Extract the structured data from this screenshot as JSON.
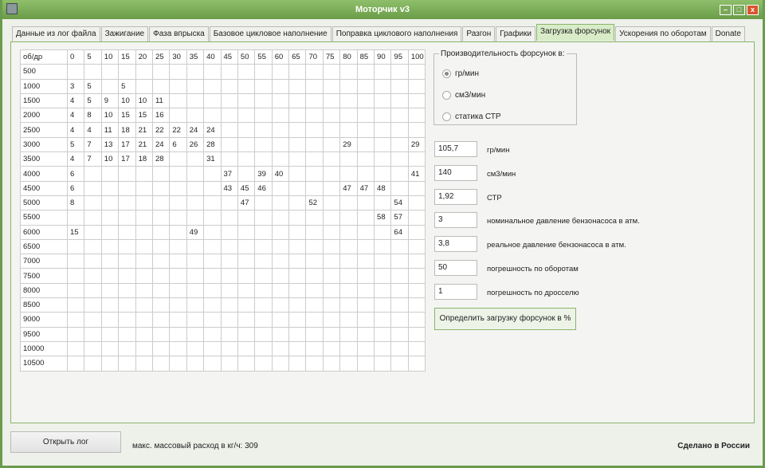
{
  "window": {
    "title": "Моторчик v3"
  },
  "tabs": [
    "Данные из лог файла",
    "Зажигание",
    "Фаза впрыска",
    "Базовое цикловое наполнение",
    "Поправка циклового наполнения",
    "Разгон",
    "Графики",
    "Загрузка форсунок",
    "Ускорения по оборотам",
    "Donate"
  ],
  "active_tab": 7,
  "table": {
    "corner": "об/др",
    "columns": [
      "0",
      "5",
      "10",
      "15",
      "20",
      "25",
      "30",
      "35",
      "40",
      "45",
      "50",
      "55",
      "60",
      "65",
      "70",
      "75",
      "80",
      "85",
      "90",
      "95",
      "100"
    ],
    "rows": [
      {
        "rpm": "500",
        "cells": {}
      },
      {
        "rpm": "1000",
        "cells": {
          "0": "3",
          "5": "5",
          "15": "5"
        }
      },
      {
        "rpm": "1500",
        "cells": {
          "0": "4",
          "5": "5",
          "10": "9",
          "15": "10",
          "20": "10",
          "25": "11"
        }
      },
      {
        "rpm": "2000",
        "cells": {
          "0": "4",
          "5": "8",
          "10": "10",
          "15": "15",
          "20": "15",
          "25": "16"
        }
      },
      {
        "rpm": "2500",
        "cells": {
          "0": "4",
          "5": "4",
          "10": "11",
          "15": "18",
          "20": "21",
          "25": "22",
          "30": "22",
          "35": "24",
          "40": "24"
        }
      },
      {
        "rpm": "3000",
        "cells": {
          "0": "5",
          "5": "7",
          "10": "13",
          "15": "17",
          "20": "21",
          "25": "24",
          "30": "6",
          "35": "26",
          "40": "28",
          "80": "29",
          "100": "29"
        }
      },
      {
        "rpm": "3500",
        "cells": {
          "0": "4",
          "5": "7",
          "10": "10",
          "15": "17",
          "20": "18",
          "25": "28",
          "40": "31"
        }
      },
      {
        "rpm": "4000",
        "cells": {
          "0": "6",
          "45": "37",
          "55": "39",
          "60": "40",
          "100": "41"
        }
      },
      {
        "rpm": "4500",
        "cells": {
          "0": "6",
          "45": "43",
          "50": "45",
          "55": "46",
          "80": "47",
          "85": "47",
          "90": "48"
        }
      },
      {
        "rpm": "5000",
        "cells": {
          "0": "8",
          "50": "47",
          "70": "52",
          "95": "54"
        }
      },
      {
        "rpm": "5500",
        "cells": {
          "90": "58",
          "95": "57"
        }
      },
      {
        "rpm": "6000",
        "cells": {
          "0": "15",
          "35": "49",
          "95": "64"
        }
      },
      {
        "rpm": "6500",
        "cells": {}
      },
      {
        "rpm": "7000",
        "cells": {}
      },
      {
        "rpm": "7500",
        "cells": {}
      },
      {
        "rpm": "8000",
        "cells": {}
      },
      {
        "rpm": "8500",
        "cells": {}
      },
      {
        "rpm": "9000",
        "cells": {}
      },
      {
        "rpm": "9500",
        "cells": {}
      },
      {
        "rpm": "10000",
        "cells": {}
      },
      {
        "rpm": "10500",
        "cells": {}
      }
    ]
  },
  "group": {
    "label": "Производительность форсунок в:",
    "options": [
      "гр/мин",
      "см3/мин",
      "статика СТР"
    ],
    "selected": 0
  },
  "fields": [
    {
      "value": "105,7",
      "label": "гр/мин"
    },
    {
      "value": "140",
      "label": "см3/мин"
    },
    {
      "value": "1,92",
      "label": "СТР"
    },
    {
      "value": "3",
      "label": "номинальное давление бензонасоса в атм."
    },
    {
      "value": "3,8",
      "label": "реальное давление бензонасоса в атм."
    },
    {
      "value": "50",
      "label": "погрешность по оборотам"
    },
    {
      "value": "1",
      "label": "погрешность по дросселю"
    }
  ],
  "calc_button": "Определить загрузку форсунок в %",
  "footer": {
    "open_log": "Открыть лог",
    "max_flow": "макс. массовый расход в кг/ч: 309",
    "made_in": "Сделано в России"
  }
}
